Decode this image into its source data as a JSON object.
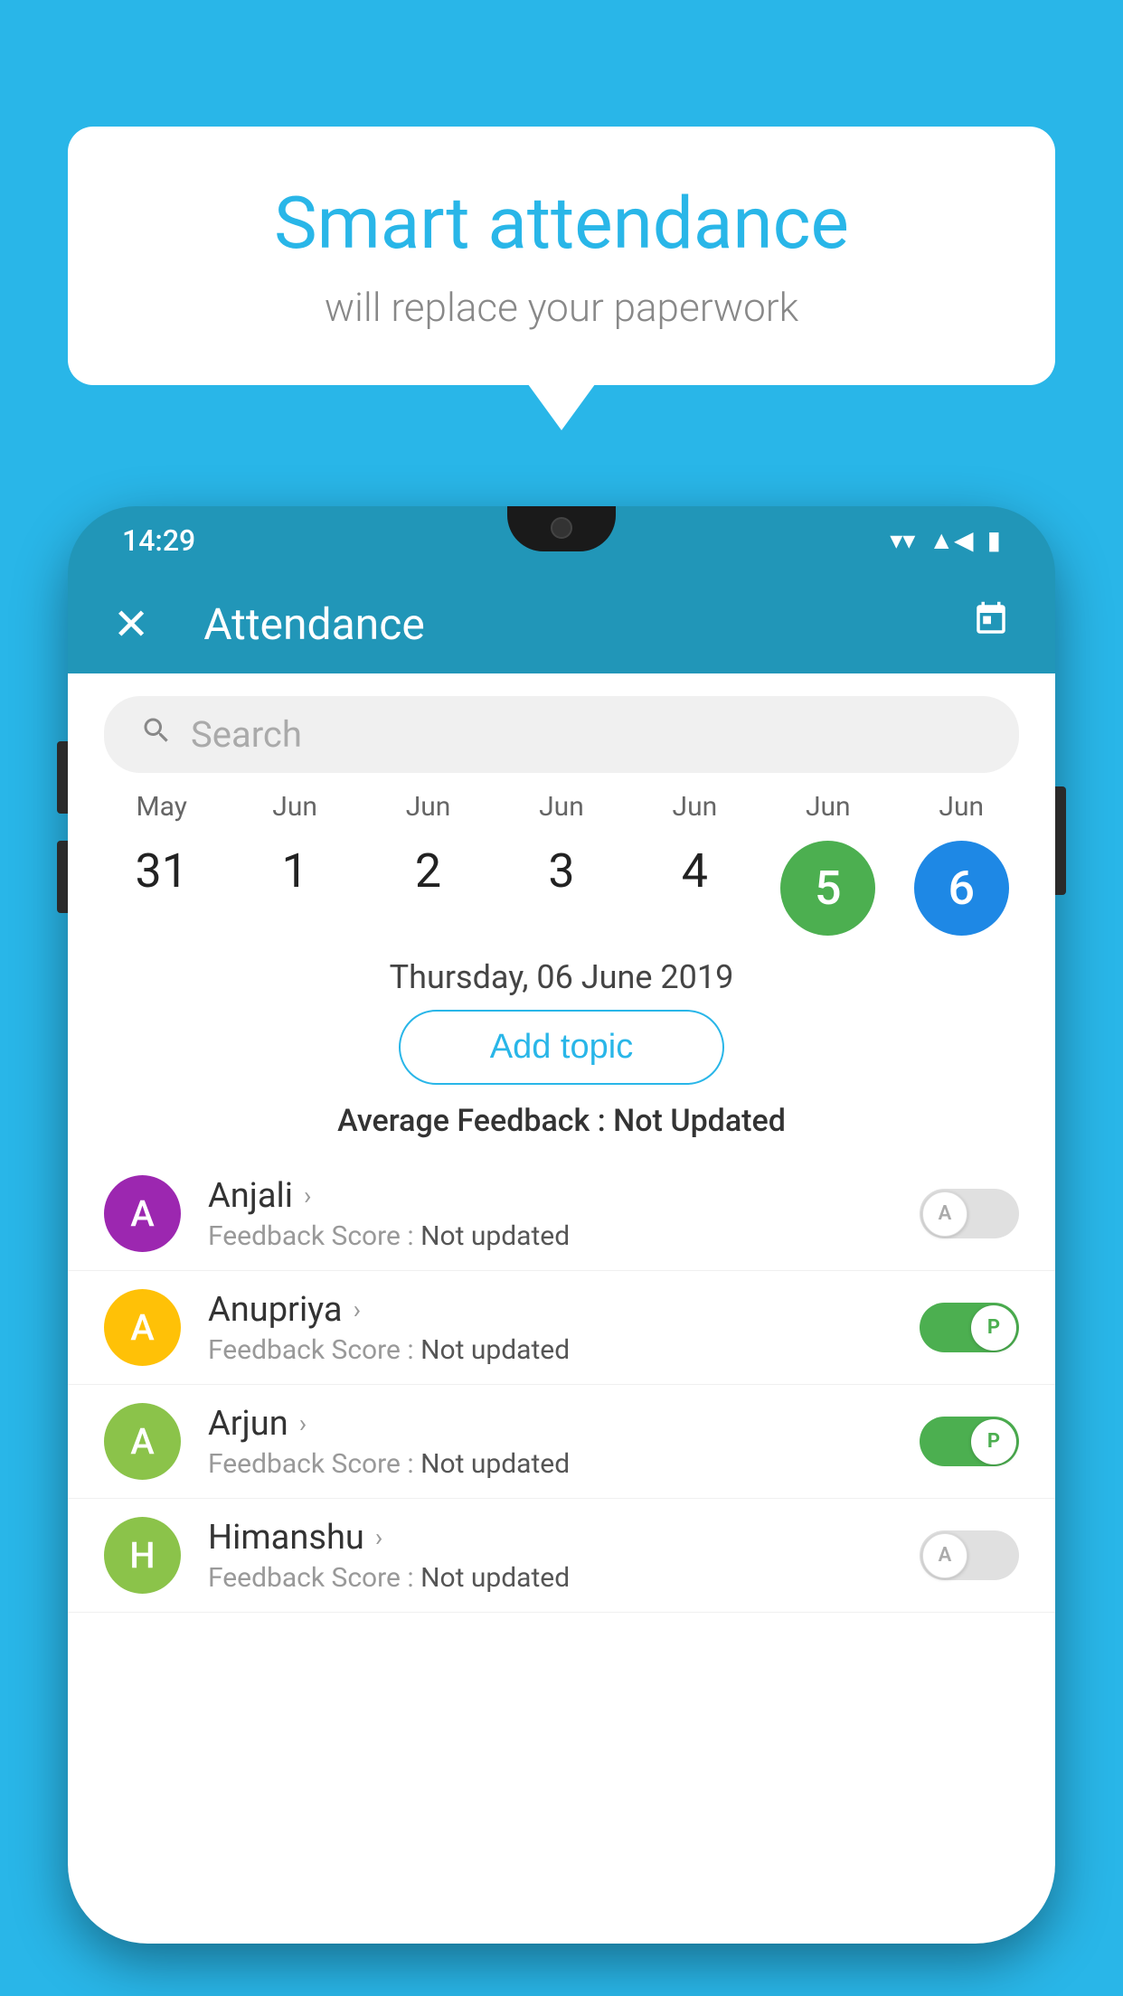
{
  "background_color": "#29b6e8",
  "speech_bubble": {
    "title": "Smart attendance",
    "subtitle": "will replace your paperwork"
  },
  "status_bar": {
    "time": "14:29",
    "wifi": "▼",
    "signal": "▲",
    "battery": "🔋"
  },
  "app_header": {
    "title": "Attendance",
    "close_label": "✕",
    "calendar_icon": "📅"
  },
  "search": {
    "placeholder": "Search"
  },
  "calendar": {
    "months": [
      "May",
      "Jun",
      "Jun",
      "Jun",
      "Jun",
      "Jun",
      "Jun"
    ],
    "dates": [
      "31",
      "1",
      "2",
      "3",
      "4",
      "5",
      "6"
    ],
    "selected_green": "5",
    "selected_blue": "6"
  },
  "selected_date_label": "Thursday, 06 June 2019",
  "add_topic_label": "Add topic",
  "avg_feedback_label": "Average Feedback : ",
  "avg_feedback_value": "Not Updated",
  "students": [
    {
      "name": "Anjali",
      "avatar_letter": "A",
      "avatar_color": "#9c27b0",
      "feedback_label": "Feedback Score : ",
      "feedback_value": "Not updated",
      "toggle_state": "off"
    },
    {
      "name": "Anupriya",
      "avatar_letter": "A",
      "avatar_color": "#ffc107",
      "feedback_label": "Feedback Score : ",
      "feedback_value": "Not updated",
      "toggle_state": "on"
    },
    {
      "name": "Arjun",
      "avatar_letter": "A",
      "avatar_color": "#8bc34a",
      "feedback_label": "Feedback Score : ",
      "feedback_value": "Not updated",
      "toggle_state": "on"
    },
    {
      "name": "Himanshu",
      "avatar_letter": "H",
      "avatar_color": "#8bc34a",
      "feedback_label": "Feedback Score : ",
      "feedback_value": "Not updated",
      "toggle_state": "off"
    }
  ],
  "toggle_labels": {
    "on": "P",
    "off": "A"
  }
}
